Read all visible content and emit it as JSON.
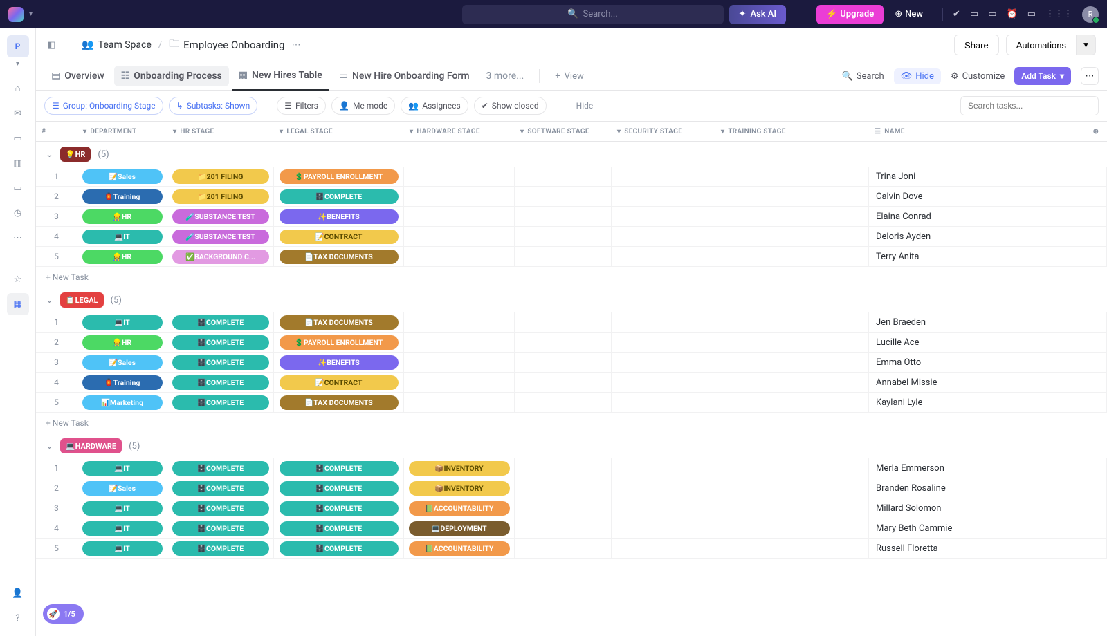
{
  "topbar": {
    "search_placeholder": "Search...",
    "ask_ai": "Ask AI",
    "upgrade": "Upgrade",
    "new_btn": "New",
    "avatar_letter": "R"
  },
  "rail": {
    "workspace_letter": "P"
  },
  "breadcrumb": {
    "space": "Team Space",
    "folder": "Employee Onboarding"
  },
  "header": {
    "share": "Share",
    "automations": "Automations"
  },
  "tabs": {
    "overview": "Overview",
    "process": "Onboarding Process",
    "table": "New Hires Table",
    "form": "New Hire Onboarding Form",
    "more": "3 more...",
    "view": "View"
  },
  "toolbar": {
    "search": "Search",
    "hide": "Hide",
    "customize": "Customize",
    "add_task": "Add Task"
  },
  "filters": {
    "group": "Group: Onboarding Stage",
    "subtasks": "Subtasks: Shown",
    "filters": "Filters",
    "me": "Me mode",
    "assignees": "Assignees",
    "closed": "Show closed",
    "hide": "Hide",
    "search_placeholder": "Search tasks..."
  },
  "columns": {
    "num": "#",
    "dept": "DEPARTMENT",
    "hr": "HR STAGE",
    "legal": "LEGAL STAGE",
    "hw": "HARDWARE STAGE",
    "sw": "SOFTWARE STAGE",
    "sec": "SECURITY STAGE",
    "tr": "TRAINING STAGE",
    "name": "NAME"
  },
  "new_task": "+ New Task",
  "progress": "1/5",
  "groups": [
    {
      "id": "hr",
      "label": "💡HR",
      "count": "(5)",
      "color": "#8b2b2b",
      "rows": [
        {
          "n": "1",
          "dept": {
            "t": "📝Sales",
            "c": "#4fc3f7"
          },
          "hr": {
            "t": "📁201 FILING",
            "c": "#f2c94c",
            "fg": "#5a4a00"
          },
          "legal": {
            "t": "💲PAYROLL ENROLLMENT",
            "c": "#f2994a"
          },
          "name": "Trina Joni"
        },
        {
          "n": "2",
          "dept": {
            "t": "🏮Training",
            "c": "#2b6cb0"
          },
          "hr": {
            "t": "📁201 FILING",
            "c": "#f2c94c",
            "fg": "#5a4a00"
          },
          "legal": {
            "t": "🗄️COMPLETE",
            "c": "#2bbbad"
          },
          "name": "Calvin Dove"
        },
        {
          "n": "3",
          "dept": {
            "t": "👷HR",
            "c": "#4cd964"
          },
          "hr": {
            "t": "🧪SUBSTANCE TEST",
            "c": "#c96bdc"
          },
          "legal": {
            "t": "✨BENEFITS",
            "c": "#7b68ee"
          },
          "name": "Elaina Conrad"
        },
        {
          "n": "4",
          "dept": {
            "t": "💻IT",
            "c": "#2bbbad"
          },
          "hr": {
            "t": "🧪SUBSTANCE TEST",
            "c": "#c96bdc"
          },
          "legal": {
            "t": "📝CONTRACT",
            "c": "#f2c94c",
            "fg": "#5a4a00"
          },
          "name": "Deloris Ayden"
        },
        {
          "n": "5",
          "dept": {
            "t": "👷HR",
            "c": "#4cd964"
          },
          "hr": {
            "t": "✅BACKGROUND C...",
            "c": "#e29ae2"
          },
          "legal": {
            "t": "📄TAX DOCUMENTS",
            "c": "#a27a2c"
          },
          "name": "Terry Anita"
        }
      ]
    },
    {
      "id": "legal",
      "label": "📋LEGAL",
      "count": "(5)",
      "color": "#e34040",
      "rows": [
        {
          "n": "1",
          "dept": {
            "t": "💻IT",
            "c": "#2bbbad"
          },
          "hr": {
            "t": "🗄️COMPLETE",
            "c": "#2bbbad"
          },
          "legal": {
            "t": "📄TAX DOCUMENTS",
            "c": "#a27a2c"
          },
          "name": "Jen Braeden"
        },
        {
          "n": "2",
          "dept": {
            "t": "👷HR",
            "c": "#4cd964"
          },
          "hr": {
            "t": "🗄️COMPLETE",
            "c": "#2bbbad"
          },
          "legal": {
            "t": "💲PAYROLL ENROLLMENT",
            "c": "#f2994a"
          },
          "name": "Lucille Ace"
        },
        {
          "n": "3",
          "dept": {
            "t": "📝Sales",
            "c": "#4fc3f7"
          },
          "hr": {
            "t": "🗄️COMPLETE",
            "c": "#2bbbad"
          },
          "legal": {
            "t": "✨BENEFITS",
            "c": "#7b68ee"
          },
          "name": "Emma Otto"
        },
        {
          "n": "4",
          "dept": {
            "t": "🏮Training",
            "c": "#2b6cb0"
          },
          "hr": {
            "t": "🗄️COMPLETE",
            "c": "#2bbbad"
          },
          "legal": {
            "t": "📝CONTRACT",
            "c": "#f2c94c",
            "fg": "#5a4a00"
          },
          "name": "Annabel Missie"
        },
        {
          "n": "5",
          "dept": {
            "t": "📊Marketing",
            "c": "#4fc3f7"
          },
          "hr": {
            "t": "🗄️COMPLETE",
            "c": "#2bbbad"
          },
          "legal": {
            "t": "📄TAX DOCUMENTS",
            "c": "#a27a2c"
          },
          "name": "Kaylani Lyle"
        }
      ]
    },
    {
      "id": "hardware",
      "label": "💻HARDWARE",
      "count": "(5)",
      "color": "#e0518c",
      "rows": [
        {
          "n": "1",
          "dept": {
            "t": "💻IT",
            "c": "#2bbbad"
          },
          "hr": {
            "t": "🗄️COMPLETE",
            "c": "#2bbbad"
          },
          "legal": {
            "t": "🗄️COMPLETE",
            "c": "#2bbbad"
          },
          "hw": {
            "t": "📦INVENTORY",
            "c": "#f2c94c",
            "fg": "#5a4a00"
          },
          "name": "Merla Emmerson"
        },
        {
          "n": "2",
          "dept": {
            "t": "📝Sales",
            "c": "#4fc3f7"
          },
          "hr": {
            "t": "🗄️COMPLETE",
            "c": "#2bbbad"
          },
          "legal": {
            "t": "🗄️COMPLETE",
            "c": "#2bbbad"
          },
          "hw": {
            "t": "📦INVENTORY",
            "c": "#f2c94c",
            "fg": "#5a4a00"
          },
          "name": "Branden Rosaline"
        },
        {
          "n": "3",
          "dept": {
            "t": "💻IT",
            "c": "#2bbbad"
          },
          "hr": {
            "t": "🗄️COMPLETE",
            "c": "#2bbbad"
          },
          "legal": {
            "t": "🗄️COMPLETE",
            "c": "#2bbbad"
          },
          "hw": {
            "t": "📗ACCOUNTABILITY",
            "c": "#f2994a"
          },
          "name": "Millard Solomon"
        },
        {
          "n": "4",
          "dept": {
            "t": "💻IT",
            "c": "#2bbbad"
          },
          "hr": {
            "t": "🗄️COMPLETE",
            "c": "#2bbbad"
          },
          "legal": {
            "t": "🗄️COMPLETE",
            "c": "#2bbbad"
          },
          "hw": {
            "t": "💻DEPLOYMENT",
            "c": "#7a5c2e"
          },
          "name": "Mary Beth Cammie"
        },
        {
          "n": "5",
          "dept": {
            "t": "💻IT",
            "c": "#2bbbad"
          },
          "hr": {
            "t": "🗄️COMPLETE",
            "c": "#2bbbad"
          },
          "legal": {
            "t": "🗄️COMPLETE",
            "c": "#2bbbad"
          },
          "hw": {
            "t": "📗ACCOUNTABILITY",
            "c": "#f2994a"
          },
          "name": "Russell Floretta"
        }
      ]
    }
  ]
}
